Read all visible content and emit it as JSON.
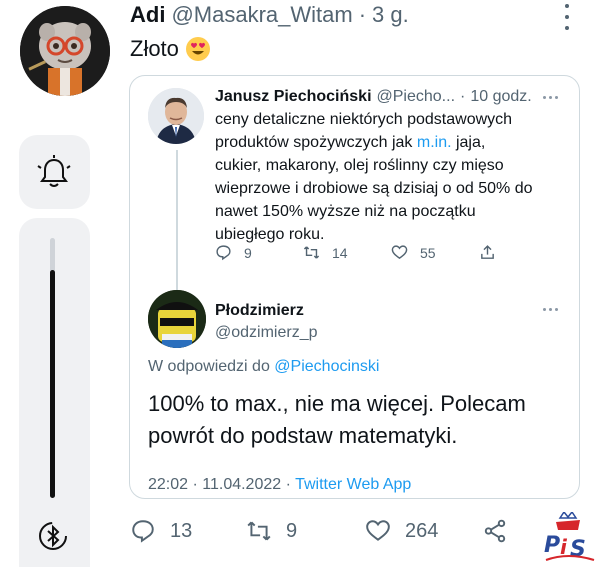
{
  "tweet": {
    "author_name": "Adi",
    "author_handle": "@Masakra_Witam",
    "separator": "·",
    "time": "3 g.",
    "text": "Złoto",
    "emoji": "heart-eyes-emoji",
    "actions": {
      "replies": "13",
      "retweets": "9",
      "likes": "264"
    }
  },
  "quoted_tweet": {
    "author_name": "Janusz Piechociński",
    "author_handle": "@Piecho...",
    "separator": "·",
    "time": "10 godz.",
    "text_lines": [
      "ceny detaliczne niektórych podstawowych",
      "produktów spożywczych jak ",
      "m.in.",
      " jaja,",
      "cukier, makarony, olej roślinny czy mięso",
      "wieprzowe i drobiowe są dzisiaj o od 50% do",
      "nawet 150% wyższe niż na początku",
      "ubiegłego roku."
    ],
    "actions": {
      "replies": "9",
      "retweets": "14",
      "likes": "55"
    }
  },
  "reply_tweet": {
    "author_name": "Płodzimierz",
    "author_handle": "@odzimierz_p",
    "reply_prefix": "W odpowiedzi do ",
    "reply_to": "@Piechocinski",
    "text_line1": "100% to max., nie ma więcej. Polecam",
    "text_line2": "powrót do podstaw matematyki.",
    "timestamp": "22:02 · 11.04.2022 · ",
    "source": "Twitter Web App"
  },
  "colors": {
    "link": "#1d9bf0",
    "muted": "#536471",
    "text": "#0f1419",
    "border": "#cfd9de"
  },
  "icons": [
    "bell-icon",
    "bluetooth-icon",
    "reply-icon",
    "retweet-icon",
    "like-icon",
    "share-icon",
    "more-icon"
  ],
  "watermark": "PiS"
}
